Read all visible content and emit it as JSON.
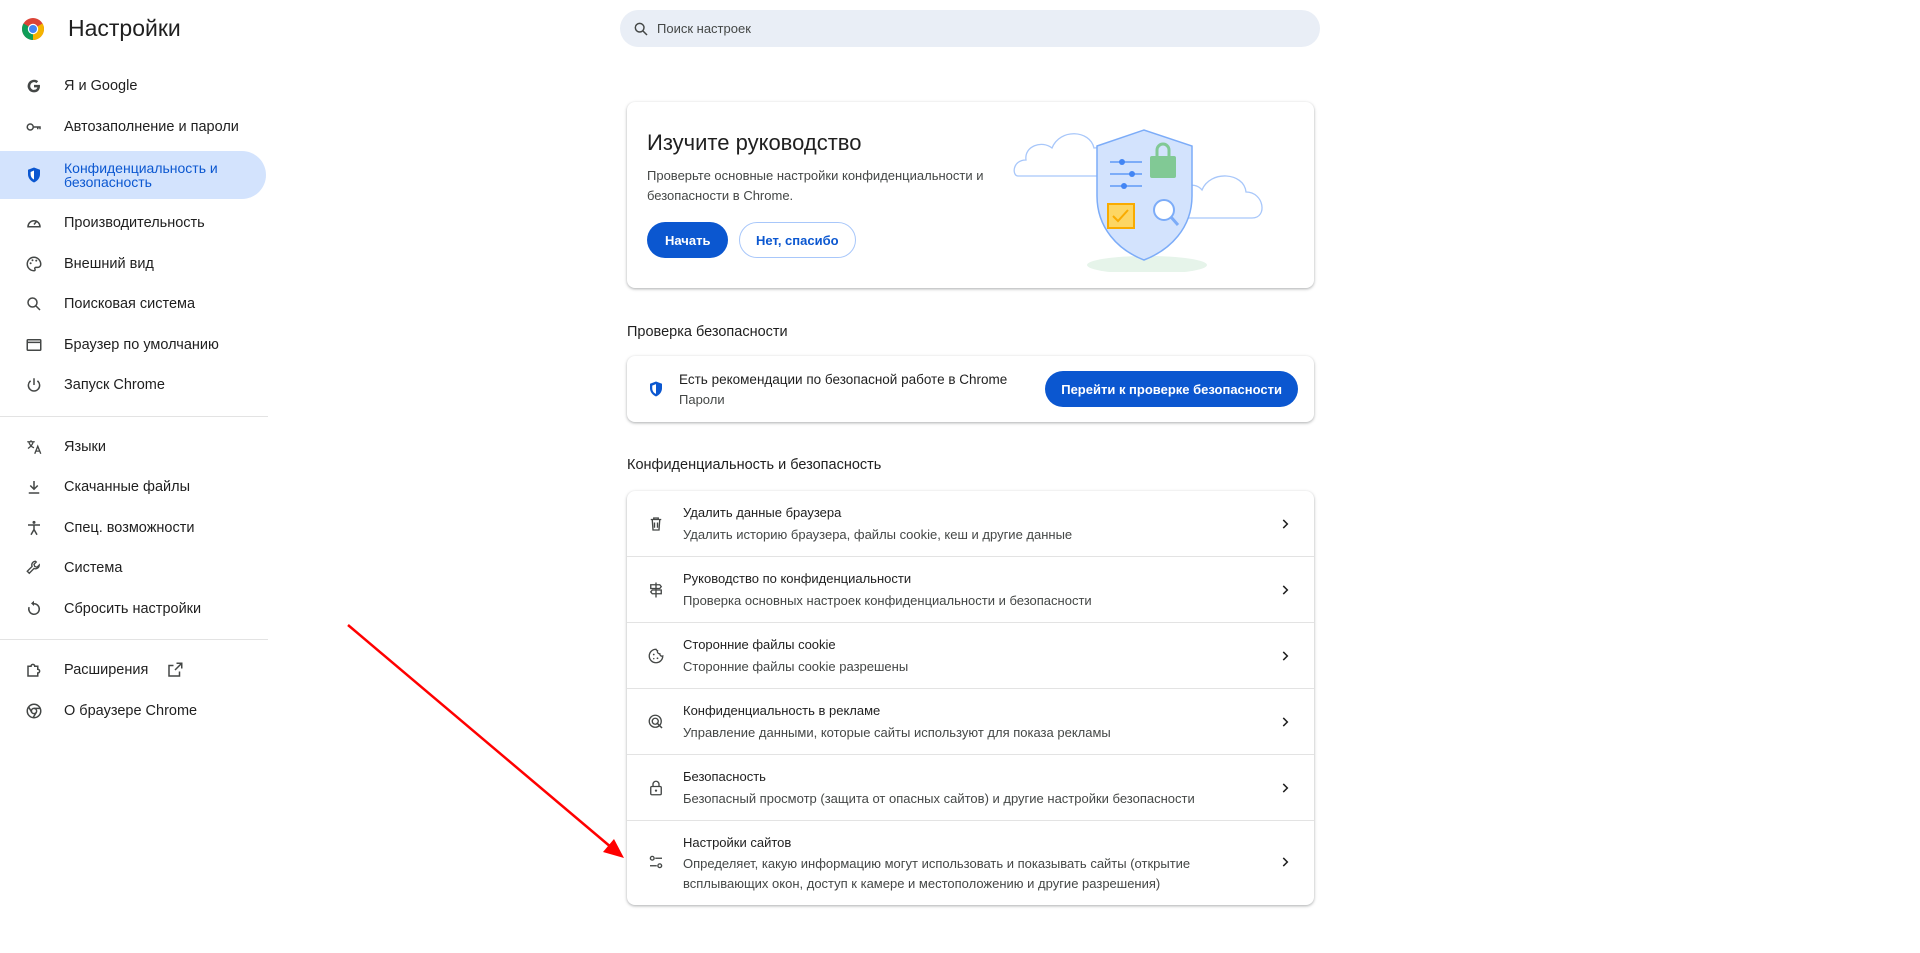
{
  "app": {
    "title": "Настройки"
  },
  "search": {
    "placeholder": "Поиск настроек"
  },
  "sidebar": {
    "items": [
      {
        "label": "Я и Google"
      },
      {
        "label": "Автозаполнение и пароли"
      },
      {
        "label": "Конфиденциальность и безопасность"
      },
      {
        "label": "Производительность"
      },
      {
        "label": "Внешний вид"
      },
      {
        "label": "Поисковая система"
      },
      {
        "label": "Браузер по умолчанию"
      },
      {
        "label": "Запуск Chrome"
      },
      {
        "label": "Языки"
      },
      {
        "label": "Скачанные файлы"
      },
      {
        "label": "Спец. возможности"
      },
      {
        "label": "Система"
      },
      {
        "label": "Сбросить настройки"
      },
      {
        "label": "Расширения"
      },
      {
        "label": "О браузере Chrome"
      }
    ]
  },
  "guide": {
    "title": "Изучите руководство",
    "description": "Проверьте основные настройки конфиденциальности и безопасности в Chrome.",
    "start_label": "Начать",
    "decline_label": "Нет, спасибо"
  },
  "safety_check": {
    "section_title": "Проверка безопасности",
    "title": "Есть рекомендации по безопасной работе в Chrome",
    "subtitle": "Пароли",
    "button_label": "Перейти к проверке безопасности"
  },
  "privacy": {
    "section_title": "Конфиденциальность и безопасность",
    "rows": [
      {
        "title": "Удалить данные браузера",
        "subtitle": "Удалить историю браузера, файлы cookie, кеш и другие данные"
      },
      {
        "title": "Руководство по конфиденциальности",
        "subtitle": "Проверка основных настроек конфиденциальности и безопасности"
      },
      {
        "title": "Сторонние файлы cookie",
        "subtitle": "Сторонние файлы cookie разрешены"
      },
      {
        "title": "Конфиденциальность в рекламе",
        "subtitle": "Управление данными, которые сайты используют для показа рекламы"
      },
      {
        "title": "Безопасность",
        "subtitle": "Безопасный просмотр (защита от опасных сайтов) и другие настройки безопасности"
      },
      {
        "title": "Настройки сайтов",
        "subtitle": "Определяет, какую информацию могут использовать и показывать сайты (открытие всплывающих окон, доступ к камере и местоположению и другие разрешения)"
      }
    ]
  },
  "colors": {
    "accent": "#0b57d0",
    "active_bg": "#d3e3fd",
    "annotation_arrow": "#ff0000"
  }
}
